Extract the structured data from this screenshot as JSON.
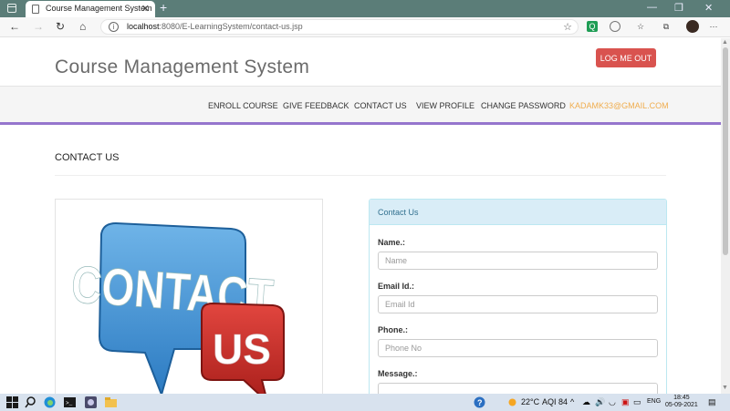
{
  "browser": {
    "tab_title": "Course Management System",
    "tab_close": "✕",
    "new_tab": "+",
    "url_host": "localhost",
    "url_rest": ":8080/E-LearningSystem/contact-us.jsp",
    "window_controls": [
      "—",
      "❐",
      "✕"
    ]
  },
  "header": {
    "title": "Course Management System",
    "logout_label": "LOG ME OUT"
  },
  "nav": {
    "items": [
      "ENROLL COURSE",
      "GIVE FEEDBACK",
      "CONTACT US",
      "VIEW PROFILE",
      "CHANGE PASSWORD"
    ],
    "email": "KADAMK33@GMAIL.COM"
  },
  "main": {
    "section_title": "CONTACT US",
    "image": {
      "word1": "CONTACT",
      "word2": "US"
    }
  },
  "form": {
    "heading": "Contact Us",
    "name_label": "Name.:",
    "name_placeholder": "Name",
    "email_label": "Email Id.:",
    "email_placeholder": "Email Id",
    "phone_label": "Phone.:",
    "phone_placeholder": "Phone No",
    "message_label": "Message.:"
  },
  "taskbar": {
    "temperature": "22°C",
    "aqi": "AQI 84",
    "language": "ENG",
    "time": "18:45",
    "date": "05-09-2021"
  },
  "colors": {
    "accent_purple": "#9575cd",
    "logout_red": "#d9534f",
    "email_orange": "#f0ad4e",
    "panel_info": "#d9edf7"
  }
}
